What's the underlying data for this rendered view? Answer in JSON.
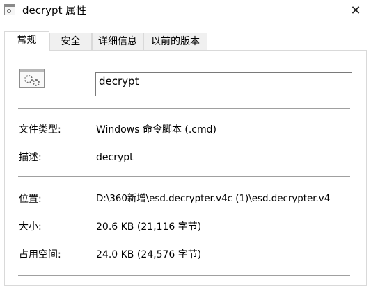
{
  "window": {
    "title": "decrypt 属性",
    "close_glyph": "✕"
  },
  "tabs": [
    {
      "label": "常规",
      "active": true
    },
    {
      "label": "安全",
      "active": false
    },
    {
      "label": "详细信息",
      "active": false
    },
    {
      "label": "以前的版本",
      "active": false
    }
  ],
  "general": {
    "file_name": "decrypt",
    "file_icon": "batch-file-gears-icon",
    "type_label": "文件类型:",
    "type_value": "Windows 命令脚本 (.cmd)",
    "desc_label": "描述:",
    "desc_value": "decrypt",
    "location_label": "位置:",
    "location_value": "D:\\360新增\\esd.decrypter.v4c (1)\\esd.decrypter.v4",
    "size_label": "大小:",
    "size_value": "20.6 KB (21,116 字节)",
    "disk_size_label": "占用空间:",
    "disk_size_value": "24.0 KB (24,576 字节)"
  }
}
